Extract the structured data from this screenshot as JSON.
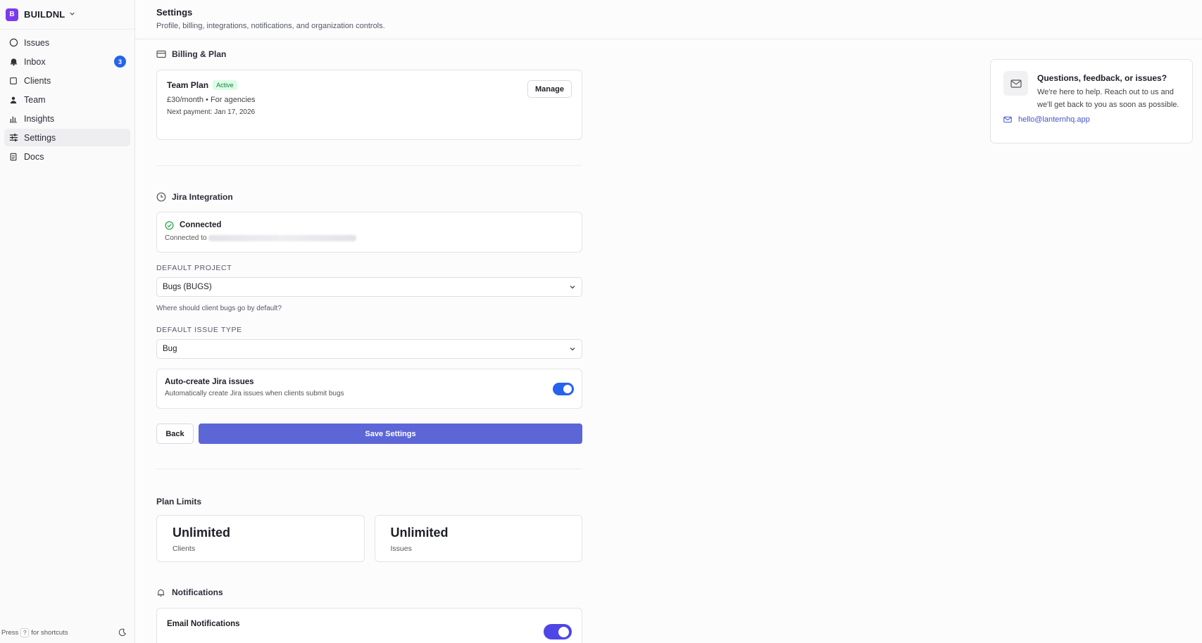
{
  "workspace": {
    "logo_letter": "B",
    "name": "BUILDNL"
  },
  "nav": {
    "items": [
      {
        "label": "Issues",
        "icon": "circle-icon"
      },
      {
        "label": "Inbox",
        "icon": "bell-icon",
        "badge": "3"
      },
      {
        "label": "Clients",
        "icon": "square-icon"
      },
      {
        "label": "Team",
        "icon": "user-icon"
      },
      {
        "label": "Insights",
        "icon": "bar-chart-icon"
      },
      {
        "label": "Settings",
        "icon": "sliders-icon",
        "active": true
      },
      {
        "label": "Docs",
        "icon": "document-icon"
      }
    ]
  },
  "footer": {
    "press": "Press",
    "key": "?",
    "suffix": "for shortcuts"
  },
  "header": {
    "title": "Settings",
    "subtitle": "Profile, billing, integrations, notifications, and organization controls."
  },
  "billing": {
    "heading": "Billing & Plan",
    "plan_name": "Team Plan",
    "status": "Active",
    "price": "£30/month • For agencies",
    "next_payment": "Next payment: Jan 17, 2026",
    "manage_label": "Manage"
  },
  "jira": {
    "heading": "Jira Integration",
    "status": "Connected",
    "connected_to": "Connected to",
    "default_project_label": "DEFAULT PROJECT",
    "default_project_value": "Bugs (BUGS)",
    "default_project_help": "Where should client bugs go by default?",
    "default_issue_type_label": "DEFAULT ISSUE TYPE",
    "default_issue_type_value": "Bug",
    "auto_create_title": "Auto-create Jira issues",
    "auto_create_desc": "Automatically create Jira issues when clients submit bugs",
    "auto_create_enabled": true
  },
  "actions": {
    "back_label": "Back",
    "save_label": "Save Settings"
  },
  "plan_limits": {
    "heading": "Plan Limits",
    "items": [
      {
        "value": "Unlimited",
        "label": "Clients"
      },
      {
        "value": "Unlimited",
        "label": "Issues"
      }
    ]
  },
  "notifications": {
    "heading": "Notifications",
    "email_title": "Email Notifications",
    "email_enabled": true
  },
  "help": {
    "title": "Questions, feedback, or issues?",
    "text": "We're here to help. Reach out to us and we'll get back to you as soon as possible.",
    "email": "hello@lanternhq.app"
  },
  "colors": {
    "accent": "#5d66d6",
    "toggle": "#2563eb",
    "badge": "#2563eb",
    "workspace_logo": "#7c3aed",
    "active_pill": "#15803d"
  }
}
